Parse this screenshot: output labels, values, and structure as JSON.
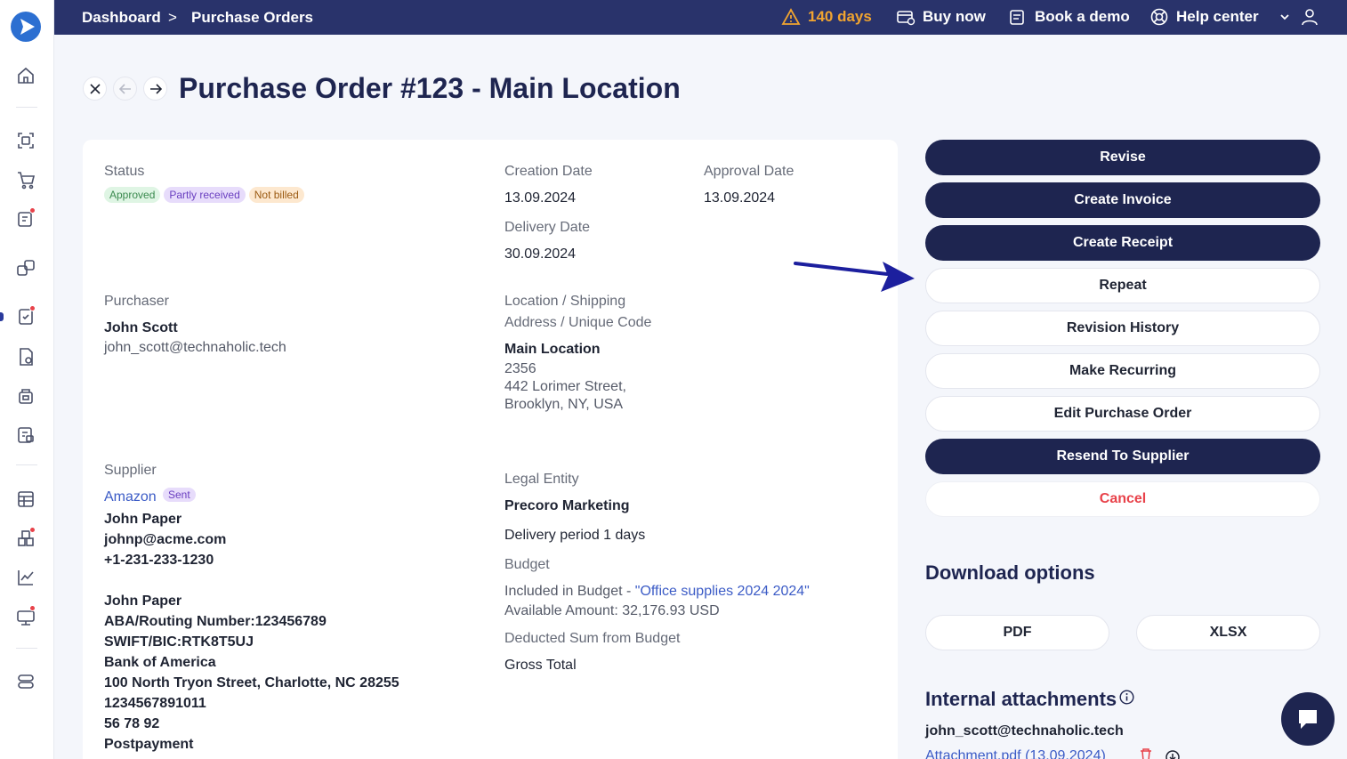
{
  "topbar": {
    "breadcrumb_home": "Dashboard",
    "breadcrumb_sep": ">",
    "breadcrumb_current": "Purchase Orders",
    "trial_days": "140 days",
    "buy_now": "Buy now",
    "book_demo": "Book a demo",
    "help_center": "Help center"
  },
  "header": {
    "title": "Purchase Order #123 - Main Location"
  },
  "details": {
    "status_label": "Status",
    "status_badges": [
      "Approved",
      "Partly received",
      "Not billed"
    ],
    "creation_date_label": "Creation Date",
    "creation_date": "13.09.2024",
    "approval_date_label": "Approval Date",
    "approval_date": "13.09.2024",
    "delivery_date_label": "Delivery Date",
    "delivery_date": "30.09.2024",
    "purchaser_label": "Purchaser",
    "purchaser_name": "John Scott",
    "purchaser_email": "john_scott@technaholic.tech",
    "location_label_1": "Location / Shipping",
    "location_label_2": "Address / Unique Code",
    "location_name": "Main Location",
    "location_code": "2356",
    "location_address_1": "442 Lorimer Street,",
    "location_address_2": "Brooklyn, NY, USA",
    "supplier_label": "Supplier",
    "supplier_name": "Amazon",
    "supplier_badge": "Sent",
    "supplier_contact": "John Paper",
    "supplier_email": "johnp@acme.com",
    "supplier_phone": "+1-231-233-1230",
    "bank_holder": "John Paper",
    "bank_routing": "ABA/Routing Number:123456789",
    "bank_swift": "SWIFT/BIC:RTK8T5UJ",
    "bank_name": "Bank of America",
    "bank_address": "100 North Tryon Street, Charlotte, NC 28255",
    "bank_account": "1234567891011",
    "bank_extra": "56 78 92",
    "payment_terms": "Postpayment",
    "legal_entity_label": "Legal Entity",
    "legal_entity": "Precoro Marketing",
    "delivery_period": "Delivery period 1 days",
    "budget_label": "Budget",
    "budget_prefix": "Included in Budget - ",
    "budget_name": "\"Office supplies 2024 2024\"",
    "budget_available": "Available Amount: 32,176.93 USD",
    "deducted_label": "Deducted Sum from Budget",
    "deducted_value": "Gross Total"
  },
  "actions": {
    "revise": "Revise",
    "create_invoice": "Create Invoice",
    "create_receipt": "Create Receipt",
    "repeat": "Repeat",
    "revision_history": "Revision History",
    "make_recurring": "Make Recurring",
    "edit_po": "Edit Purchase Order",
    "resend": "Resend To Supplier",
    "cancel": "Cancel"
  },
  "downloads": {
    "heading": "Download options",
    "pdf": "PDF",
    "xlsx": "XLSX"
  },
  "attachments": {
    "heading": "Internal attachments",
    "uploader": "john_scott@technaholic.tech",
    "file": "Attachment.pdf (13.09.2024)"
  },
  "colors": {
    "primary": "#1e2550",
    "topbar": "#29336b",
    "accent_link": "#3b5bc6",
    "danger": "#e8424a",
    "warning": "#f0a430"
  }
}
